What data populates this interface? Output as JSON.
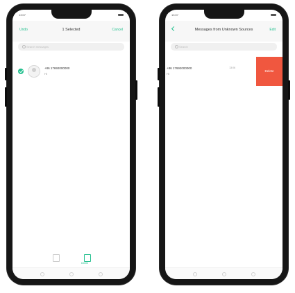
{
  "left_screen": {
    "status_time": "13:07",
    "header": {
      "left": "Undo",
      "title": "1 Selected",
      "right": "Cancel"
    },
    "search": {
      "placeholder": "Search messages"
    },
    "message": {
      "sender": "+86 17692000000",
      "preview": "Hi"
    },
    "bottom_bar": {
      "delete_label": "Delete"
    }
  },
  "right_screen": {
    "status_time": "13:07",
    "header": {
      "title": "Messages from Unknown Sources",
      "right": "Edit"
    },
    "search": {
      "placeholder": "Search"
    },
    "message": {
      "sender": "+86 17692000000",
      "preview": "Hi",
      "time": "13:06"
    },
    "swipe_action": {
      "label": "Delete"
    }
  },
  "colors": {
    "accent": "#24c08f",
    "delete": "#f0573f"
  },
  "icons": [
    "back-icon",
    "search-icon",
    "checkmark-icon",
    "avatar-icon",
    "trash-icon",
    "copy-icon"
  ]
}
